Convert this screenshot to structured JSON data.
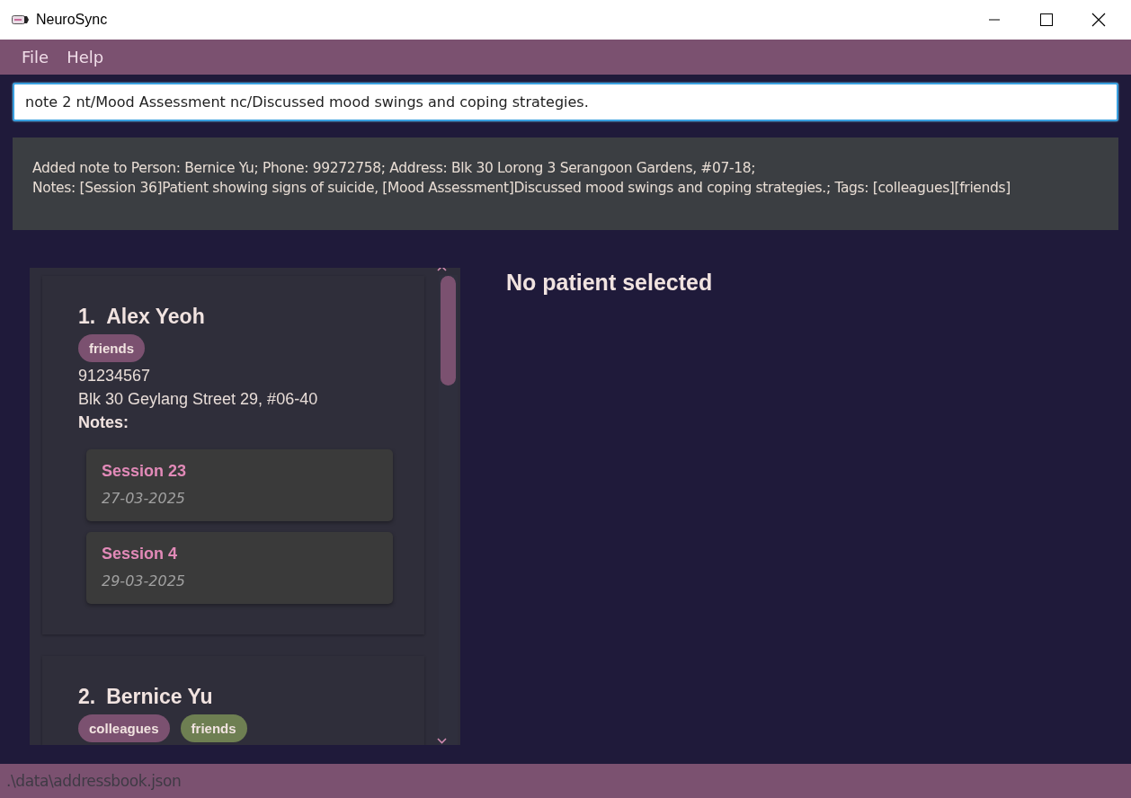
{
  "window": {
    "title": "NeuroSync"
  },
  "menu": [
    {
      "label": "File"
    },
    {
      "label": "Help"
    }
  ],
  "command": {
    "value": "note 2 nt/Mood Assessment nc/Discussed mood swings and coping strategies."
  },
  "result": {
    "lines": [
      "Added note to Person: Bernice Yu; Phone: 99272758; Address: Blk 30 Lorong 3 Serangoon Gardens, #07-18;",
      "Notes: [Session 36]Patient showing signs of suicide, [Mood Assessment]Discussed mood swings and coping strategies.; Tags: [colleagues][friends]"
    ]
  },
  "patients": [
    {
      "index": "1.",
      "name": "Alex Yeoh",
      "tags": [
        {
          "label": "friends",
          "color": "#7b5170"
        }
      ],
      "phone": "91234567",
      "address": "Blk 30 Geylang Street 29, #06-40",
      "notes_label": "Notes:",
      "notes": [
        {
          "title": "Session 23",
          "date": "27-03-2025"
        },
        {
          "title": "Session 4",
          "date": "29-03-2025"
        }
      ]
    },
    {
      "index": "2.",
      "name": "Bernice Yu",
      "tags": [
        {
          "label": "colleagues",
          "color": "#7b5170"
        },
        {
          "label": "friends",
          "color": "#6e7f52"
        }
      ]
    }
  ],
  "detail": {
    "message": "No patient selected"
  },
  "status_bar": {
    "path": ".\\data\\addressbook.json"
  }
}
